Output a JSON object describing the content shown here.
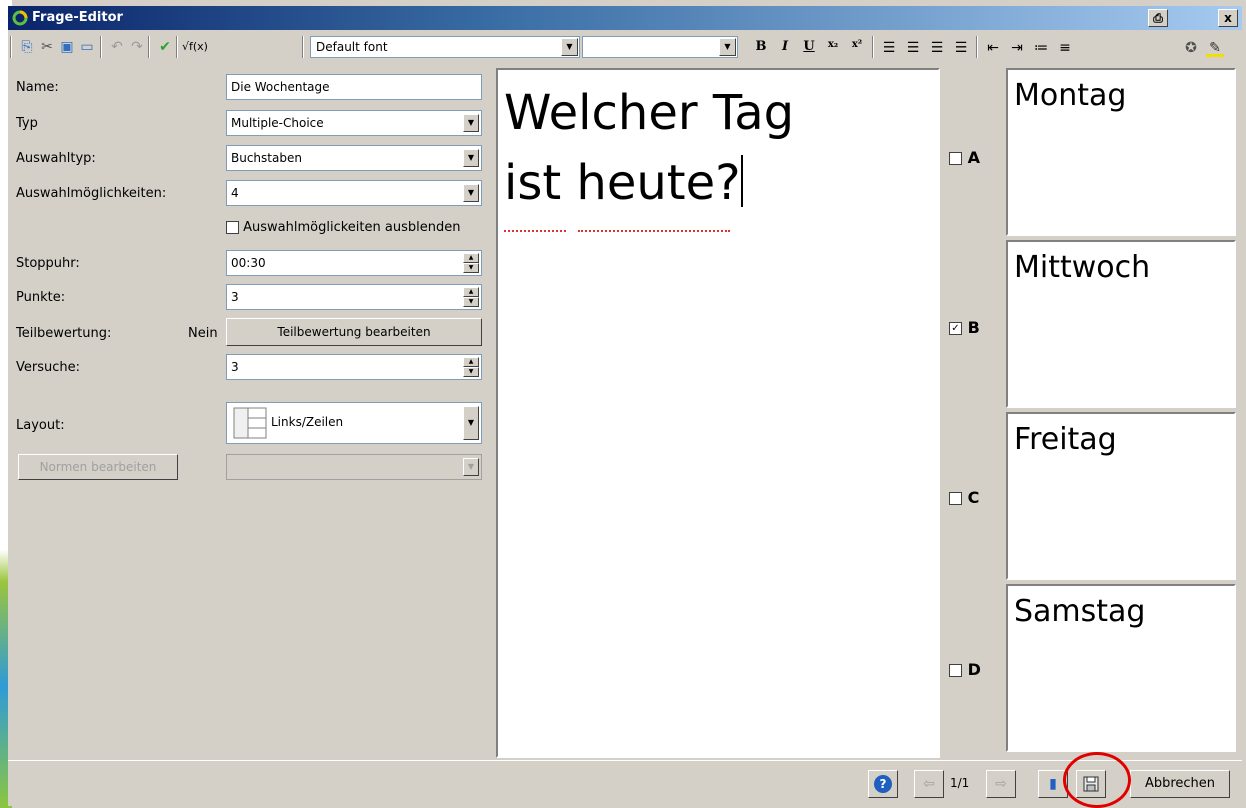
{
  "window": {
    "title": "Frage-Editor",
    "buttons": {
      "restore": "⎙",
      "close": "x"
    }
  },
  "toolbar": {
    "font_value": "Default font",
    "size_value": "",
    "format": {
      "bold": "B",
      "italic": "I",
      "underline": "U",
      "subscript": "x₂",
      "superscript": "x²"
    }
  },
  "props": {
    "name_label": "Name:",
    "name_value": "Die Wochentage",
    "typ_label": "Typ",
    "typ_value": "Multiple-Choice",
    "auswahltyp_label": "Auswahltyp:",
    "auswahltyp_value": "Buchstaben",
    "moeglichkeiten_label": "Auswahlmöglichkeiten:",
    "moeglichkeiten_value": "4",
    "ausblenden_label": "Auswahlmöglickeiten ausblenden",
    "stoppuhr_label": "Stoppuhr:",
    "stoppuhr_value": "00:30",
    "punkte_label": "Punkte:",
    "punkte_value": "3",
    "teilbewertung_label": "Teilbewertung:",
    "teilbewertung_status": "Nein",
    "teilbewertung_button": "Teilbewertung bearbeiten",
    "versuche_label": "Versuche:",
    "versuche_value": "3",
    "layout_label": "Layout:",
    "layout_value": "Links/Zeilen",
    "normen_button": "Normen bearbeiten"
  },
  "question": {
    "line1": "Welcher Tag",
    "line2": "ist heute?"
  },
  "answers": [
    {
      "letter": "A",
      "text": "Montag",
      "checked": false
    },
    {
      "letter": "B",
      "text": "Mittwoch",
      "checked": true
    },
    {
      "letter": "C",
      "text": "Freitag",
      "checked": false
    },
    {
      "letter": "D",
      "text": "Samstag",
      "checked": false
    }
  ],
  "footer": {
    "page": "1/1",
    "cancel_button": "Abbrechen"
  },
  "colors": {
    "accent": "#0a246a",
    "highlight": "#e00000",
    "panel": "#d4d0c8"
  }
}
